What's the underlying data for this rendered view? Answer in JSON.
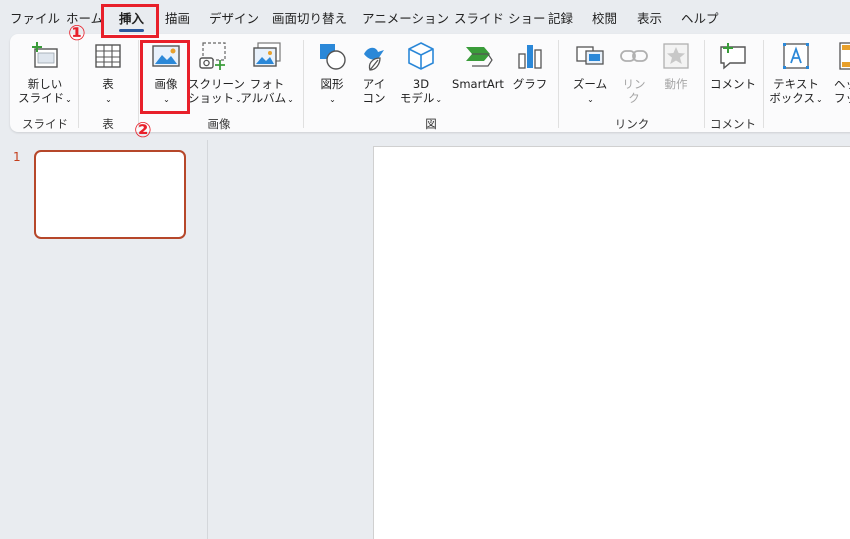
{
  "tabs": [
    "ファイル",
    "ホーム",
    "挿入",
    "描画",
    "デザイン",
    "画面切り替え",
    "アニメーション",
    "スライド ショー",
    "記録",
    "校閲",
    "表示",
    "ヘルプ"
  ],
  "ribbon": {
    "slides": {
      "new_slide_1": "新しい",
      "new_slide_2": "スライド",
      "group": "スライド"
    },
    "tables": {
      "table": "表",
      "group": "表"
    },
    "images": {
      "picture": "画像",
      "screenshot_1": "スクリーン",
      "screenshot_2": "ショット",
      "album_1": "フォト",
      "album_2": "アルバム",
      "group": "画像"
    },
    "illustrations": {
      "shapes": "図形",
      "icons_1": "アイ",
      "icons_2": "コン",
      "model_1": "3D",
      "model_2": "モデル",
      "smartart": "SmartArt",
      "chart": "グラフ",
      "group": "図"
    },
    "links": {
      "zoom": "ズーム",
      "link_1": "リン",
      "link_2": "ク",
      "action": "動作",
      "group": "リンク"
    },
    "comments": {
      "comment": "コメント",
      "group": "コメント"
    },
    "text": {
      "textbox_1": "テキスト",
      "textbox_2": "ボックス",
      "header_1": "ヘッダ",
      "header_2": "フッ"
    }
  },
  "thumbnails": {
    "slide_number": "1"
  },
  "annotations": {
    "step1": "①",
    "step2": "②",
    "color": "#e8202a"
  },
  "icons": [
    "new-slide-icon",
    "table-icon",
    "picture-icon",
    "screenshot-icon",
    "photo-album-icon",
    "shapes-icon",
    "icons-icon",
    "3d-model-icon",
    "smartart-icon",
    "chart-icon",
    "zoom-icon",
    "link-icon",
    "action-icon",
    "comment-icon",
    "textbox-icon",
    "header-footer-icon"
  ]
}
